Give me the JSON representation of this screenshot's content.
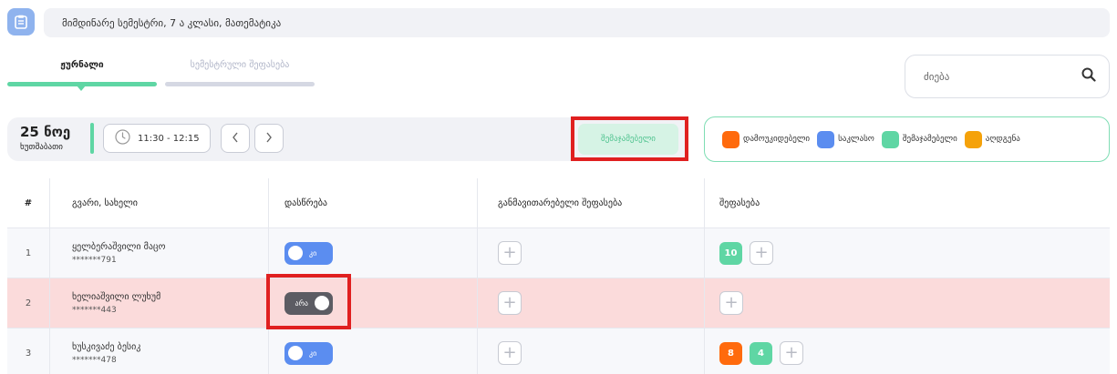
{
  "header": {
    "title": "მიმდინარე სემესტრი, 7 ა კლასი, მათემატიკა",
    "icon": "clipboard-icon"
  },
  "tabs": [
    {
      "label": "ჟურნალი",
      "active": true
    },
    {
      "label": "სემესტრული შეფასება",
      "active": false
    }
  ],
  "search": {
    "placeholder": "ძიება",
    "icon": "search-icon"
  },
  "date": {
    "day": "25 ნოე",
    "weekday": "ხუთშაბათი"
  },
  "lesson_time": "11:30 - 12:15",
  "summary_button_label": "შემაჯამებელი",
  "legend": [
    {
      "label": "დამოუკიდებელი",
      "color": "#ff6a0d"
    },
    {
      "label": "საკლასო",
      "color": "#5b8df0"
    },
    {
      "label": "შემაჯამებელი",
      "color": "#5fd6a4"
    },
    {
      "label": "აღდგენა",
      "color": "#f5a20a"
    }
  ],
  "table": {
    "headers": {
      "number": "#",
      "name": "გვარი, სახელი",
      "attendance": "დასწრება",
      "achievement": "განმავითარებელი შეფასება",
      "grade": "შეფასება"
    },
    "rows": [
      {
        "number": "1",
        "name": "ყელბერაშვილი მაცო",
        "id": "*******791",
        "attendance_label": "კი",
        "present": true,
        "grades": [
          {
            "value": "10",
            "color": "#5fd6a4"
          }
        ]
      },
      {
        "number": "2",
        "name": "ხელიაშვილი ლუხუმ",
        "id": "*******443",
        "attendance_label": "არა",
        "present": false,
        "grades": []
      },
      {
        "number": "3",
        "name": "ხუსკივაძე ბესიკ",
        "id": "*******478",
        "attendance_label": "კი",
        "present": true,
        "grades": [
          {
            "value": "8",
            "color": "#ff6a0d"
          },
          {
            "value": "4",
            "color": "#5fd6a4"
          }
        ]
      }
    ]
  },
  "plus_symbol": "+"
}
